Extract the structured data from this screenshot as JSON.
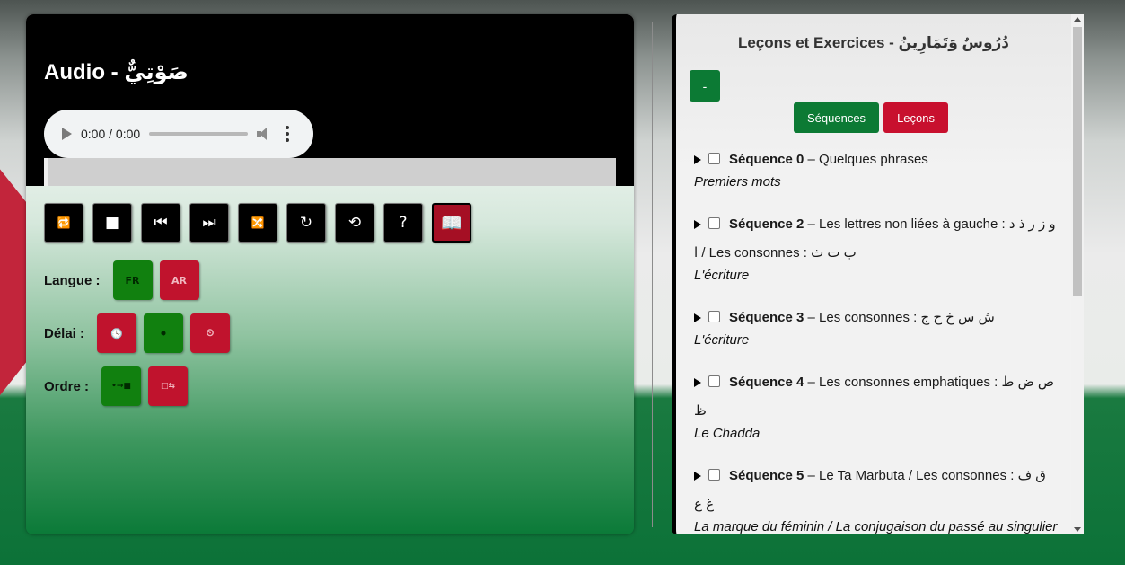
{
  "audio": {
    "title": "Audio - صَوْتِيٌّ",
    "player_time": "0:00 / 0:00"
  },
  "controls": [
    {
      "name": "repeat-icon",
      "glyph": "🔁"
    },
    {
      "name": "stop-icon",
      "glyph": "■"
    },
    {
      "name": "previous-icon",
      "glyph": "⏮"
    },
    {
      "name": "next-icon",
      "glyph": "⏭"
    },
    {
      "name": "shuffle-icon",
      "glyph": "🔀"
    },
    {
      "name": "reload-icon",
      "glyph": "↻"
    },
    {
      "name": "undo-icon",
      "glyph": "⟲"
    },
    {
      "name": "help-icon",
      "glyph": "?"
    },
    {
      "name": "book-icon",
      "glyph": "📖"
    }
  ],
  "options": {
    "langue_label": "Langue :",
    "langue_fr": "FR",
    "langue_ar": "AR",
    "delai_label": "Délai :",
    "delai_icons": [
      "🕓",
      "⚫",
      "⏲"
    ],
    "ordre_label": "Ordre :",
    "ordre_icons": [
      "•→■",
      "□⇆"
    ]
  },
  "lessons": {
    "title": "Leçons et Exercices - دُرُوسٌ وَتَمَارِينُ",
    "minus_label": "-",
    "tab_sequences": "Séquences",
    "tab_lecons": "Leçons",
    "items": [
      {
        "name": "Séquence 0",
        "desc": " – Quelques phrases",
        "sub": "Premiers mots"
      },
      {
        "name": "Séquence 2",
        "desc": " – Les lettres non liées à gauche : و ز ر ذ د ا / Les consonnes : ب ت ث",
        "sub": "L'écriture"
      },
      {
        "name": "Séquence 3",
        "desc": " – Les consonnes : ش س خ ح ج",
        "sub": "L'écriture"
      },
      {
        "name": "Séquence 4",
        "desc": " – Les consonnes emphatiques : ص ض ط ظ",
        "sub": "Le Chadda"
      },
      {
        "name": "Séquence 5",
        "desc": " – Le Ta Marbuta / Les consonnes : ق ف غ ع",
        "sub": "La marque du féminin / La conjugaison du passé au singulier"
      }
    ]
  },
  "colors": {
    "green": "#11800f",
    "red": "#c0132d",
    "dark_green": "#0c7a34"
  }
}
